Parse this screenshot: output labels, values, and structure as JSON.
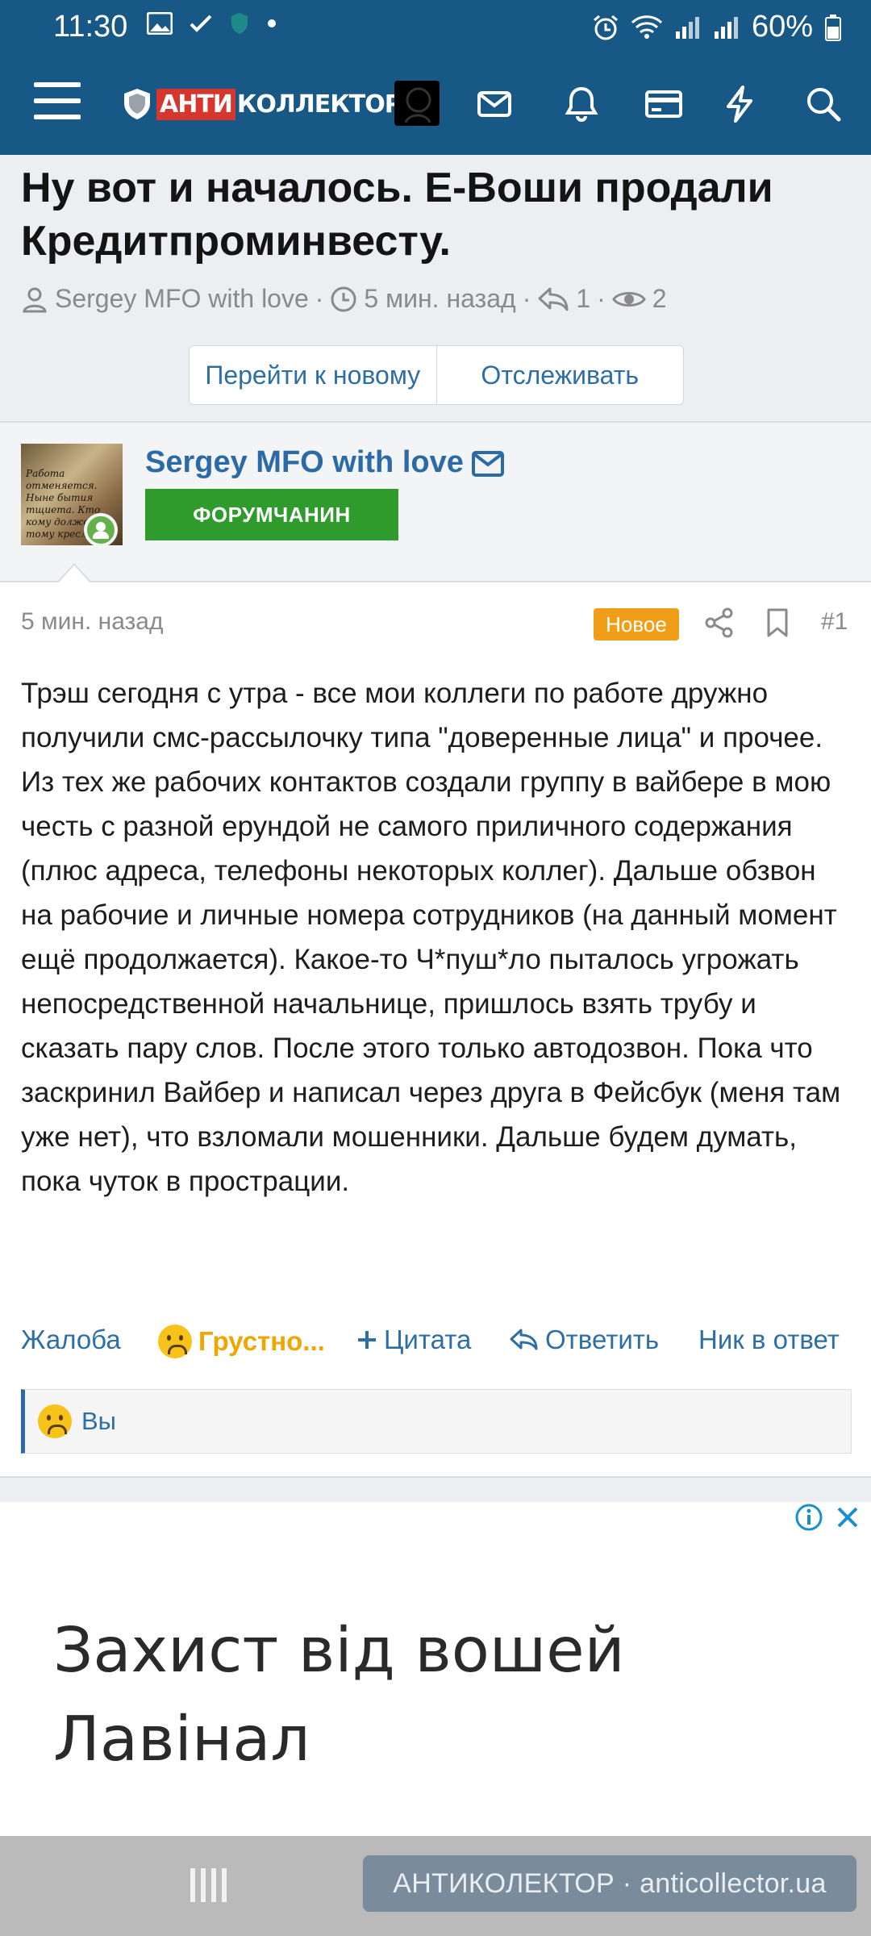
{
  "status_bar": {
    "time": "11:30",
    "battery": "60%"
  },
  "app_bar": {
    "logo_part1": "АНТИ",
    "logo_part2": "КОЛЛЕКТОР",
    "icons": [
      "menu-icon",
      "avatar",
      "mail-icon",
      "bell-icon",
      "card-icon",
      "lightning-icon",
      "search-icon"
    ]
  },
  "thread": {
    "title": "Ну вот и началось. Е-Воши продали Кредитпроминвесту.",
    "author": "Sergey MFO with love",
    "time": "5 мин. назад",
    "replies": "1",
    "views": "2",
    "separator": "·",
    "goto_new": "Перейти к новому",
    "watch": "Отслеживать"
  },
  "post": {
    "username": "Sergey MFO with love",
    "rank": "ФОРУМЧАНИН",
    "avatar_text": "Работа отменяется. Ныне бытия тщиета. Кто кому должен, тому кресло!",
    "time": "5 мин. назад",
    "badge": "Новое",
    "number": "#1",
    "body": "Трэш сегодня с утра - все мои коллеги по работе дружно получили смс-рассылочку типа \"доверенные лица\" и прочее. Из тех же рабочих контактов создали группу в вайбере в мою честь с разной ерундой не самого приличного содержания (плюс адреса, телефоны некоторых коллег). Дальше обзвон на рабочие и личные номера сотрудников (на данный момент ещё продолжается). Какое-то Ч*пуш*ло пыталось угрожать непосредственной начальнице, пришлось взять трубу и сказать пару слов. После этого только автодозвон. Пока что заскринил Вайбер и написал через друга в Фейсбук (меня там уже нет), что взломали мошенники. Дальше будем думать, пока чуток в прострации.",
    "actions": {
      "report": "Жалоба",
      "reaction": "Грустно...",
      "quote": "Цитата",
      "reply": "Ответить",
      "mention": "Ник в ответ"
    },
    "reactions_by": "Вы"
  },
  "ad": {
    "title": "Захист від вошей Лавінал"
  },
  "watermark": "АНТИКОЛЕКТОР · anticollector.ua",
  "colors": {
    "header_bg": "#185886",
    "link": "#2e6ea6",
    "rank_bg": "#2f9b2d",
    "badge_bg": "#f09d17",
    "logo_red": "#d8362c"
  }
}
